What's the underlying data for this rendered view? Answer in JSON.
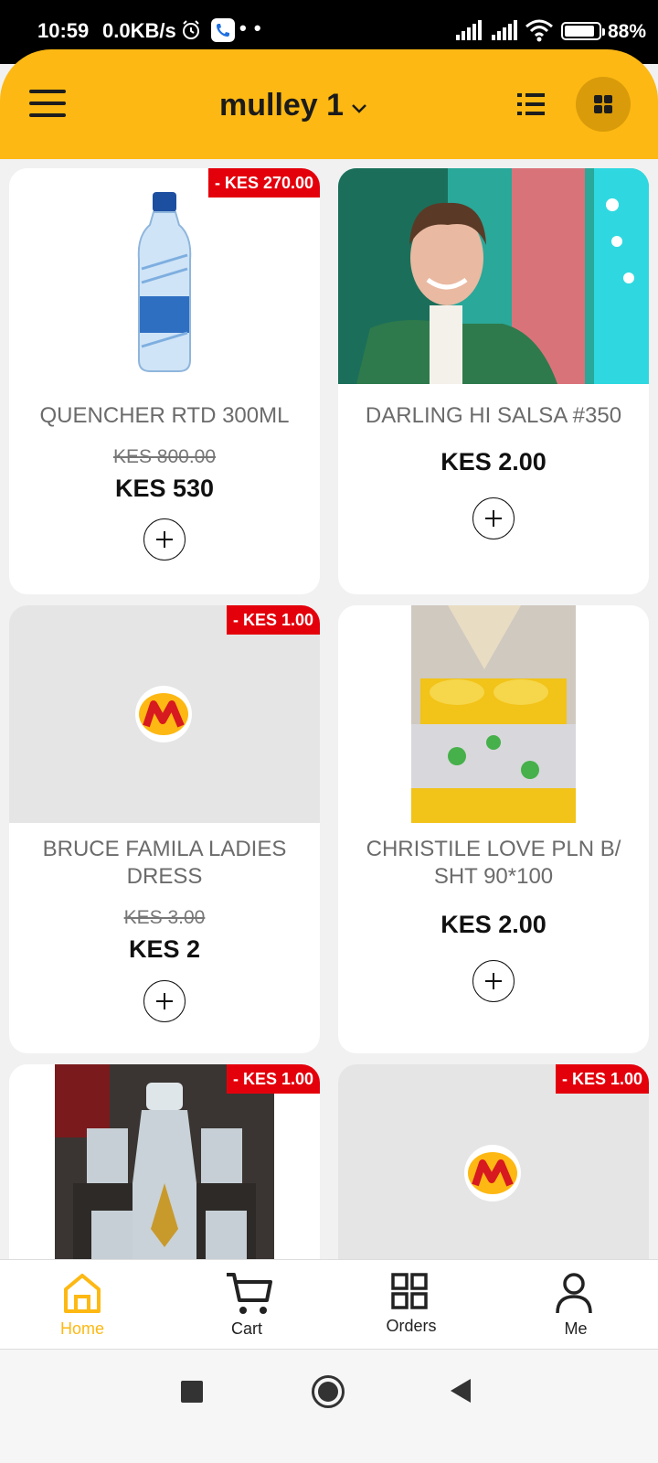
{
  "status_bar": {
    "time": "10:59",
    "speed": "0.0KB/s",
    "dots": "• •",
    "battery_pct": "88%",
    "battery_level": 0.88
  },
  "header": {
    "store_name": "mulley 1",
    "accent_color": "#fdb813",
    "icons": [
      "menu-icon",
      "chevron-down-icon",
      "list-view-icon",
      "grid-view-icon"
    ]
  },
  "products": [
    {
      "name": "QUENCHER RTD 300ML",
      "badge": "- KES 270.00",
      "old_price": "KES 800.00",
      "price": "KES 530",
      "image": "water-bottle"
    },
    {
      "name": "DARLING HI SALSA #350",
      "price": "KES 2.00",
      "image": "smiling-man-photo"
    },
    {
      "name": "BRUCE FAMILA LADIES DRESS",
      "badge": "- KES 1.00",
      "old_price": "KES 3.00",
      "price": "KES 2",
      "image": "placeholder-logo"
    },
    {
      "name": "CHRISTILE LOVE PLN B/ SHT 90*100",
      "price": "KES 2.00",
      "image": "bedsheet-photo"
    },
    {
      "badge": "- KES 1.00",
      "image": "glassware-set-photo"
    },
    {
      "badge": "- KES 1.00",
      "image": "placeholder-logo"
    }
  ],
  "bottom_nav": {
    "items": [
      {
        "label": "Home",
        "icon": "home-icon",
        "active": true
      },
      {
        "label": "Cart",
        "icon": "cart-icon"
      },
      {
        "label": "Orders",
        "icon": "orders-icon"
      },
      {
        "label": "Me",
        "icon": "profile-icon"
      }
    ]
  },
  "colors": {
    "badge": "#e4000b",
    "logo_red": "#d71920",
    "logo_yellow": "#fdb813"
  }
}
